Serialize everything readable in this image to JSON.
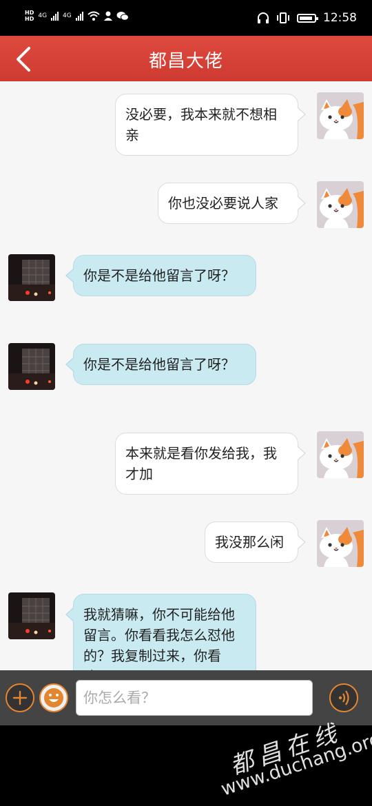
{
  "status_bar": {
    "hd": "HD",
    "network_a": "4G",
    "network_b": "4G",
    "time": "12:58"
  },
  "header": {
    "title": "都昌大佬"
  },
  "messages": [
    {
      "side": "me",
      "text": "没必要，我本来就不想相亲"
    },
    {
      "side": "me",
      "text": "你也没必要说人家"
    },
    {
      "side": "them",
      "text": "你是不是给他留言了呀？"
    },
    {
      "side": "them",
      "text": "你是不是给他留言了呀？"
    },
    {
      "side": "me",
      "text": "本来就是看你发给我，我才加"
    },
    {
      "side": "me",
      "text": "我没那么闲"
    },
    {
      "side": "them",
      "text": "我就猜嘛，你不可能给他留言。你看看我怎么怼他的？我复制过来，你看嘛。"
    }
  ],
  "input": {
    "placeholder": "你怎么看？"
  },
  "icons": {
    "back": "chevron-left-icon",
    "plus": "plus-icon",
    "emoji": "smiley-icon",
    "voice": "voice-wave-icon",
    "cat_avatar": "cat-avatar-icon"
  },
  "watermark": {
    "line1": "都昌在线",
    "line2": "www.duchang.org"
  },
  "colors": {
    "header": "#d9423a",
    "me_bubble": "#ffffff",
    "them_bubble": "#c9eaf1",
    "accent": "#e48630"
  }
}
